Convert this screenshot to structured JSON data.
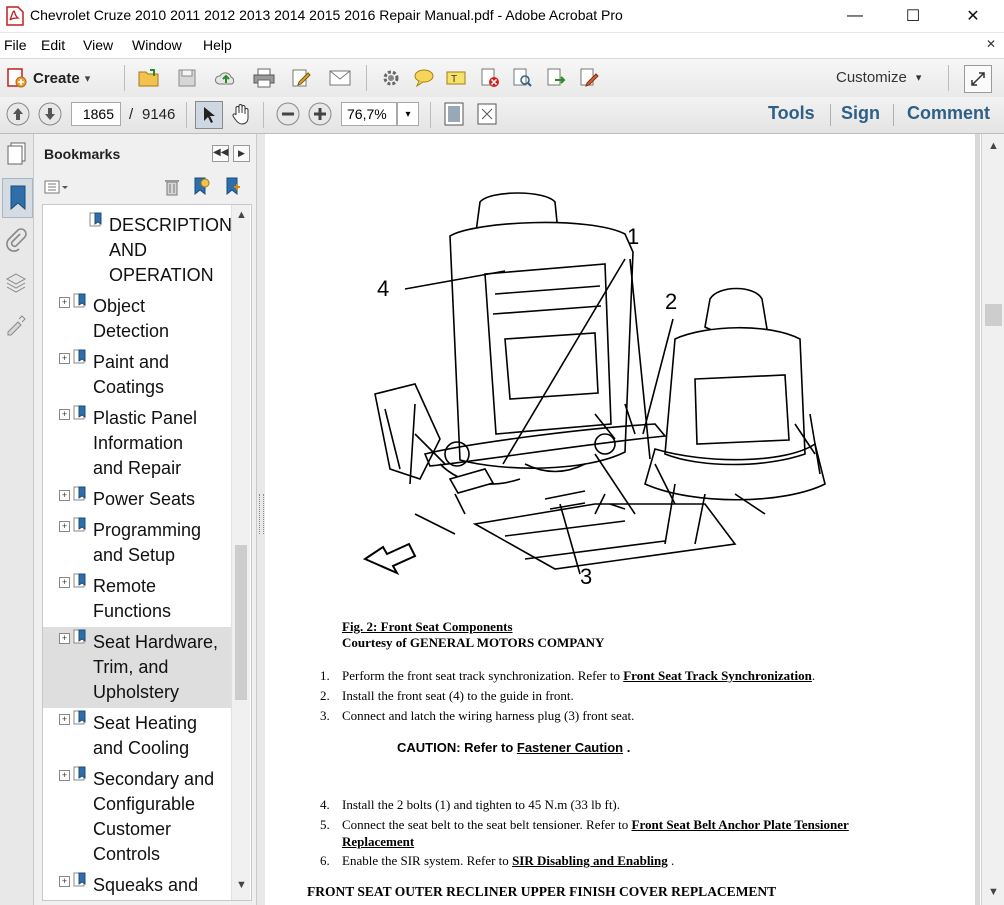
{
  "window": {
    "title": "Chevrolet Cruze 2010 2011 2012 2013 2014 2015 2016 Repair Manual.pdf - Adobe Acrobat Pro",
    "minimize": "—",
    "maximize": "☐",
    "close": "✕"
  },
  "menu": {
    "items": [
      "File",
      "Edit",
      "View",
      "Window",
      "Help"
    ],
    "close_doc": "✕"
  },
  "toolbar": {
    "create_label": "Create",
    "customize_label": "Customize",
    "dropdown_arrow": "▾"
  },
  "nav": {
    "current_page": "1865",
    "page_separator": "/",
    "total_pages": "9146",
    "zoom": "76,7%",
    "tools_label": "Tools",
    "sign_label": "Sign",
    "comment_label": "Comment"
  },
  "bookmarks": {
    "title": "Bookmarks",
    "items": [
      {
        "label": "DESCRIPTION AND OPERATION",
        "lines": [
          "DESCRIPTION",
          "AND",
          "OPERATION"
        ],
        "expandable": false,
        "selected": false
      },
      {
        "label": "Object Detection",
        "lines": [
          "Object",
          "Detection"
        ],
        "expandable": true,
        "selected": false
      },
      {
        "label": "Paint and Coatings",
        "lines": [
          "Paint and",
          "Coatings"
        ],
        "expandable": true,
        "selected": false
      },
      {
        "label": "Plastic Panel Information and Repair",
        "lines": [
          "Plastic Panel",
          "Information",
          "and Repair"
        ],
        "expandable": true,
        "selected": false
      },
      {
        "label": "Power Seats",
        "lines": [
          "Power Seats"
        ],
        "expandable": true,
        "selected": false
      },
      {
        "label": "Programming and Setup",
        "lines": [
          "Programming",
          "and Setup"
        ],
        "expandable": true,
        "selected": false
      },
      {
        "label": "Remote Functions",
        "lines": [
          "Remote",
          "Functions"
        ],
        "expandable": true,
        "selected": false
      },
      {
        "label": "Seat Hardware, Trim, and Upholstery",
        "lines": [
          "Seat Hardware,",
          "Trim, and",
          "Upholstery"
        ],
        "expandable": true,
        "selected": true
      },
      {
        "label": "Seat Heating and Cooling",
        "lines": [
          "Seat Heating",
          "and Cooling"
        ],
        "expandable": true,
        "selected": false
      },
      {
        "label": "Secondary and Configurable Customer Controls",
        "lines": [
          "Secondary and",
          "Configurable",
          "Customer",
          "Controls"
        ],
        "expandable": true,
        "selected": false
      },
      {
        "label": "Squeaks and",
        "lines": [
          "Squeaks and"
        ],
        "expandable": true,
        "selected": false
      }
    ]
  },
  "document": {
    "figure_callouts": [
      "1",
      "2",
      "3",
      "4"
    ],
    "figure_caption": "Fig. 2: Front Seat Components",
    "figure_courtesy": "Courtesy of GENERAL MOTORS COMPANY",
    "steps": [
      {
        "num": "1.",
        "text": "Perform the front seat track synchronization. Refer to ",
        "link": "Front Seat Track Synchronization",
        "after": "."
      },
      {
        "num": "2.",
        "text": "Install the front seat (4) to the guide in front.",
        "link": "",
        "after": ""
      },
      {
        "num": "3.",
        "text": "Connect and latch the wiring harness plug (3) front seat.",
        "link": "",
        "after": ""
      }
    ],
    "caution_prefix": "CAUTION: Refer to ",
    "caution_link": "Fastener Caution",
    "caution_suffix": " .",
    "steps2": [
      {
        "num": "4.",
        "text": "Install the 2 bolts (1) and tighten to 45 N.m (33 lb ft).",
        "link": "",
        "after": ""
      },
      {
        "num": "5.",
        "text": "Connect the seat belt to the seat belt tensioner. Refer to ",
        "link": "Front Seat Belt Anchor Plate Tensioner",
        "link2": "Replacement",
        "after": ""
      },
      {
        "num": "6.",
        "text": "Enable the SIR system. Refer to ",
        "link": "SIR Disabling and Enabling",
        "after": " ."
      }
    ],
    "section_heading": "FRONT SEAT OUTER RECLINER UPPER FINISH COVER REPLACEMENT"
  },
  "colors": {
    "accent_blue": "#2f5f86",
    "pdf_red": "#d42020"
  }
}
